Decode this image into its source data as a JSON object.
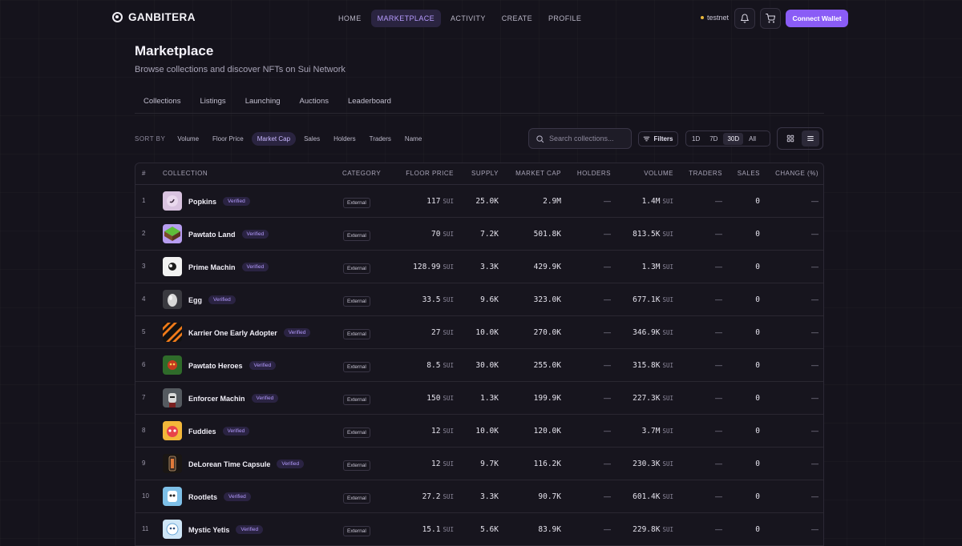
{
  "brand": {
    "name": "GANBITERA"
  },
  "nav": [
    "HOME",
    "MARKETPLACE",
    "ACTIVITY",
    "CREATE",
    "PROFILE"
  ],
  "network": "testnet",
  "connect_label": "Connect Wallet",
  "header": {
    "title": "Marketplace",
    "subtitle": "Browse collections and discover NFTs on Sui Network"
  },
  "tabs": [
    "Collections",
    "Listings",
    "Launching",
    "Auctions",
    "Leaderboard"
  ],
  "sort": {
    "label": "SORT BY",
    "options": [
      "Volume",
      "Floor Price",
      "Market Cap",
      "Sales",
      "Holders",
      "Traders",
      "Name"
    ],
    "active": "Market Cap"
  },
  "search": {
    "placeholder": "Search collections..."
  },
  "filters_label": "Filters",
  "time_ranges": [
    "1D",
    "7D",
    "30D",
    "All"
  ],
  "time_active": "30D",
  "colors": {
    "accent": "#8a5cf6",
    "background": "#15131c",
    "badge_text": "#b49bff",
    "testnet_dot": "#e8b73a"
  },
  "table": {
    "headers": [
      "#",
      "COLLECTION",
      "CATEGORY",
      "FLOOR PRICE",
      "SUPPLY",
      "MARKET CAP",
      "HOLDERS",
      "VOLUME",
      "TRADERS",
      "SALES",
      "CHANGE (%)"
    ],
    "unit": "SUI",
    "verified_label": "Verified",
    "rows": [
      {
        "num": "1",
        "name": "Popkins",
        "category": "External",
        "floor": "117",
        "supply": "25.0K",
        "mcap": "2.9M",
        "holders": "—",
        "volume": "1.4M",
        "traders": "—",
        "sales": "0",
        "change": "—",
        "thumb": "popkins"
      },
      {
        "num": "2",
        "name": "Pawtato Land",
        "category": "External",
        "floor": "70",
        "supply": "7.2K",
        "mcap": "501.8K",
        "holders": "—",
        "volume": "813.5K",
        "traders": "—",
        "sales": "0",
        "change": "—",
        "thumb": "land"
      },
      {
        "num": "3",
        "name": "Prime Machin",
        "category": "External",
        "floor": "128.99",
        "supply": "3.3K",
        "mcap": "429.9K",
        "holders": "—",
        "volume": "1.3M",
        "traders": "—",
        "sales": "0",
        "change": "—",
        "thumb": "prime"
      },
      {
        "num": "4",
        "name": "Egg",
        "category": "External",
        "floor": "33.5",
        "supply": "9.6K",
        "mcap": "323.0K",
        "holders": "—",
        "volume": "677.1K",
        "traders": "—",
        "sales": "0",
        "change": "—",
        "thumb": "egg"
      },
      {
        "num": "5",
        "name": "Karrier One Early Adopter",
        "category": "External",
        "floor": "27",
        "supply": "10.0K",
        "mcap": "270.0K",
        "holders": "—",
        "volume": "346.9K",
        "traders": "—",
        "sales": "0",
        "change": "—",
        "thumb": "karrier"
      },
      {
        "num": "6",
        "name": "Pawtato Heroes",
        "category": "External",
        "floor": "8.5",
        "supply": "30.0K",
        "mcap": "255.0K",
        "holders": "—",
        "volume": "315.8K",
        "traders": "—",
        "sales": "0",
        "change": "—",
        "thumb": "heroes"
      },
      {
        "num": "7",
        "name": "Enforcer Machin",
        "category": "External",
        "floor": "150",
        "supply": "1.3K",
        "mcap": "199.9K",
        "holders": "—",
        "volume": "227.3K",
        "traders": "—",
        "sales": "0",
        "change": "—",
        "thumb": "enforcer"
      },
      {
        "num": "8",
        "name": "Fuddies",
        "category": "External",
        "floor": "12",
        "supply": "10.0K",
        "mcap": "120.0K",
        "holders": "—",
        "volume": "3.7M",
        "traders": "—",
        "sales": "0",
        "change": "—",
        "thumb": "fuddies"
      },
      {
        "num": "9",
        "name": "DeLorean Time Capsule",
        "category": "External",
        "floor": "12",
        "supply": "9.7K",
        "mcap": "116.2K",
        "holders": "—",
        "volume": "230.3K",
        "traders": "—",
        "sales": "0",
        "change": "—",
        "thumb": "delorean"
      },
      {
        "num": "10",
        "name": "Rootlets",
        "category": "External",
        "floor": "27.2",
        "supply": "3.3K",
        "mcap": "90.7K",
        "holders": "—",
        "volume": "601.4K",
        "traders": "—",
        "sales": "0",
        "change": "—",
        "thumb": "rootlets"
      },
      {
        "num": "11",
        "name": "Mystic Yetis",
        "category": "External",
        "floor": "15.1",
        "supply": "5.6K",
        "mcap": "83.9K",
        "holders": "—",
        "volume": "229.8K",
        "traders": "—",
        "sales": "0",
        "change": "—",
        "thumb": "yetis"
      }
    ]
  }
}
